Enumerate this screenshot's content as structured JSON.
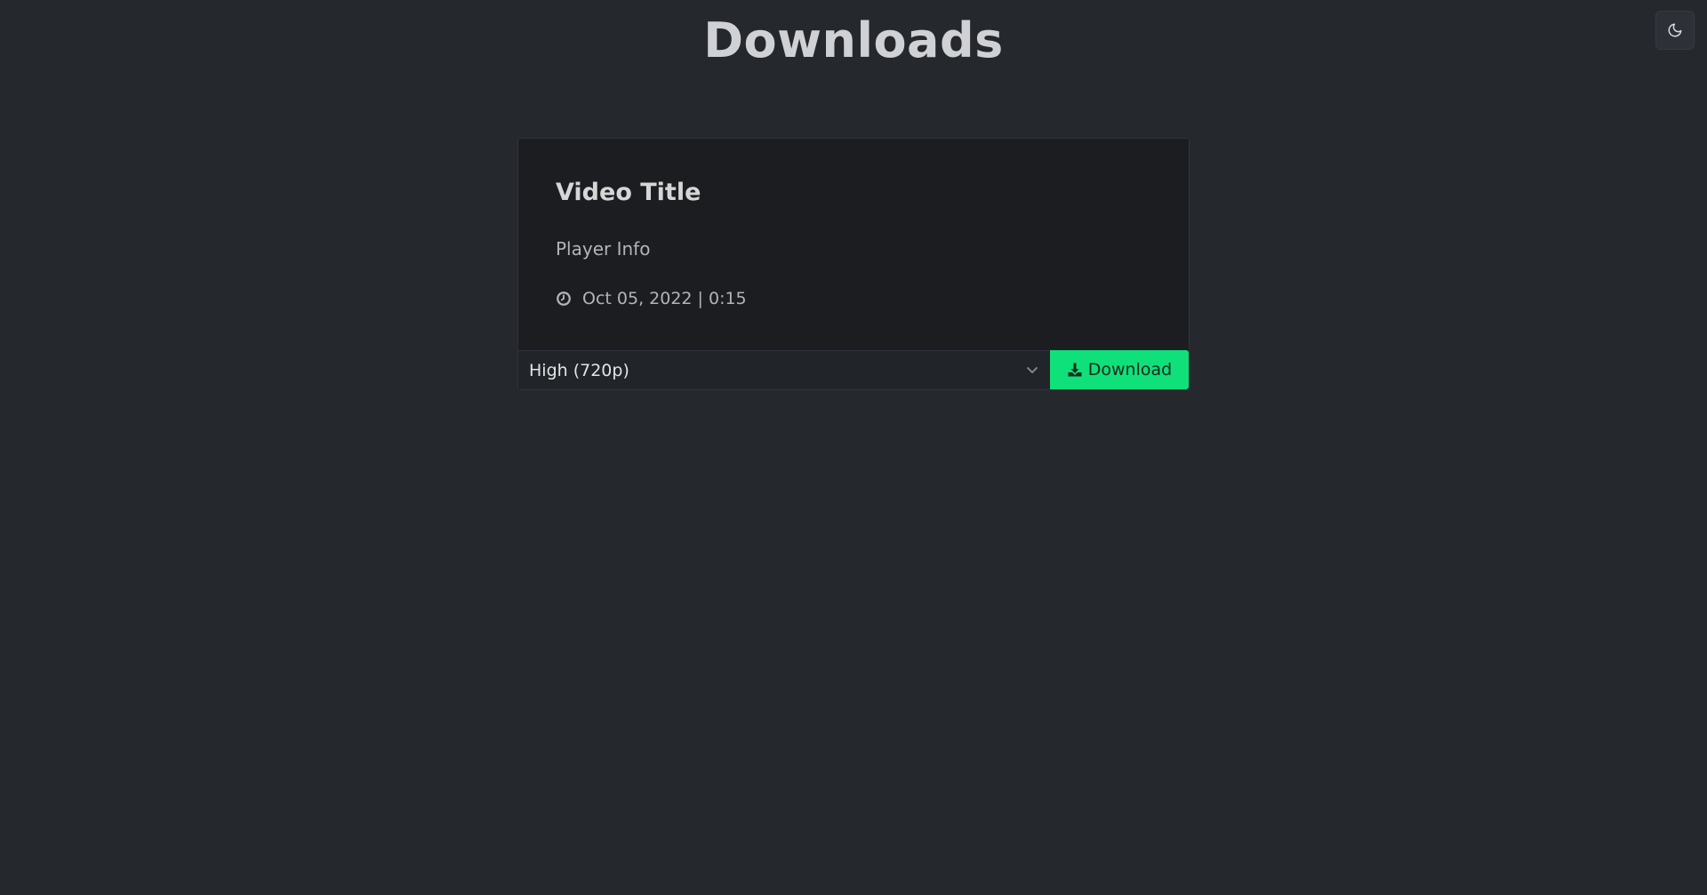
{
  "header": {
    "title": "Downloads",
    "theme_toggle_icon": "moon-icon"
  },
  "video": {
    "title": "Video Title",
    "player_info": "Player Info",
    "meta_icon": "clock-icon",
    "date_duration": "Oct 05, 2022 | 0:15"
  },
  "download": {
    "quality_selected": "High (720p)",
    "quality_icon": "chevron-down-icon",
    "button_label": "Download",
    "button_icon": "download-icon"
  },
  "colors": {
    "background": "#25282d",
    "card": "#1b1d21",
    "accent": "#10e07a"
  }
}
